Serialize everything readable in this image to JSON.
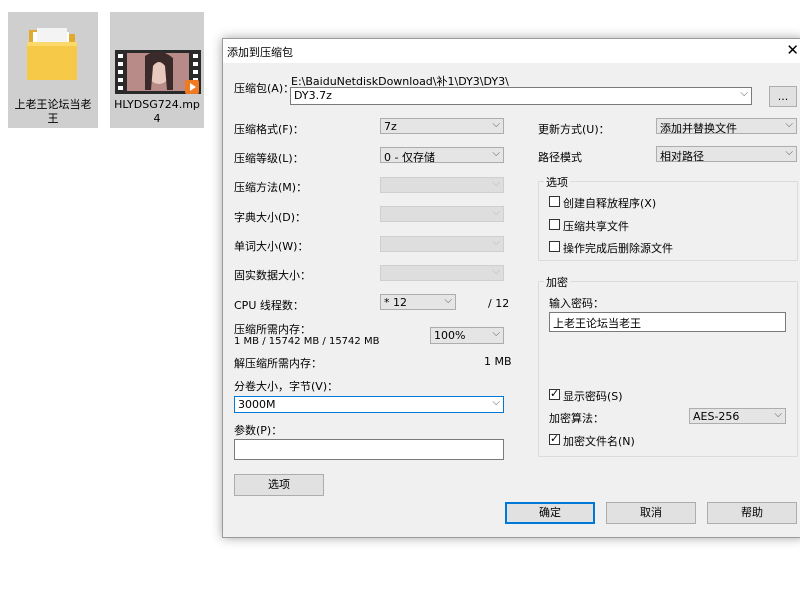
{
  "desktop": {
    "icons": [
      {
        "caption_line1": "上老王论坛当老",
        "caption_line2": "王",
        "type": "folder"
      },
      {
        "caption_line1": "HLYDSG724.mp",
        "caption_line2": "4",
        "type": "video"
      }
    ]
  },
  "dialog": {
    "title": "添加到压缩包",
    "archive_label": "压缩包(A)：",
    "archive_path": "E:\\BaiduNetdiskDownload\\补1\\DY3\\DY3\\",
    "archive_name": "DY3.7z",
    "browse_label": "...",
    "left": {
      "format_label": "压缩格式(F)：",
      "format_value": "7z",
      "level_label": "压缩等级(L)：",
      "level_value": "0 - 仅存储",
      "method_label": "压缩方法(M)：",
      "dict_label": "字典大小(D)：",
      "word_label": "单词大小(W)：",
      "solid_label": "固实数据大小：",
      "cpu_label": "CPU 线程数：",
      "cpu_value": "* 12",
      "cpu_total": "/ 12",
      "mem_comp_label": "压缩所需内存：",
      "mem_comp_value": "1 MB / 15742 MB / 15742 MB",
      "mem_percent": "100%",
      "mem_decomp_label": "解压缩所需内存：",
      "mem_decomp_value": "1 MB",
      "volume_label": "分卷大小，字节(V)：",
      "volume_value": "3000M",
      "params_label": "参数(P)：",
      "params_value": "",
      "options_button": "选项"
    },
    "right": {
      "update_label": "更新方式(U)：",
      "update_value": "添加并替换文件",
      "path_label": "路径模式",
      "path_value": "相对路径",
      "options_group": "选项",
      "opt_sfx": "创建自释放程序(X)",
      "opt_sfx_checked": false,
      "opt_shared": "压缩共享文件",
      "opt_shared_checked": false,
      "opt_delete": "操作完成后删除源文件",
      "opt_delete_checked": false,
      "encrypt_group": "加密",
      "password_label": "输入密码：",
      "password_value": "上老王论坛当老王",
      "show_password": "显示密码(S)",
      "show_password_checked": true,
      "enc_method_label": "加密算法：",
      "enc_method_value": "AES-256",
      "encrypt_names": "加密文件名(N)",
      "encrypt_names_checked": true
    },
    "buttons": {
      "ok": "确定",
      "cancel": "取消",
      "help": "帮助"
    },
    "close_glyph": "✕",
    "dropdown_glyph": "⌵",
    "check_glyph": "✓"
  },
  "colors": {
    "dialog_bg": "#f0f0f0",
    "accent": "#0078d7",
    "folder": "#f7c948"
  }
}
